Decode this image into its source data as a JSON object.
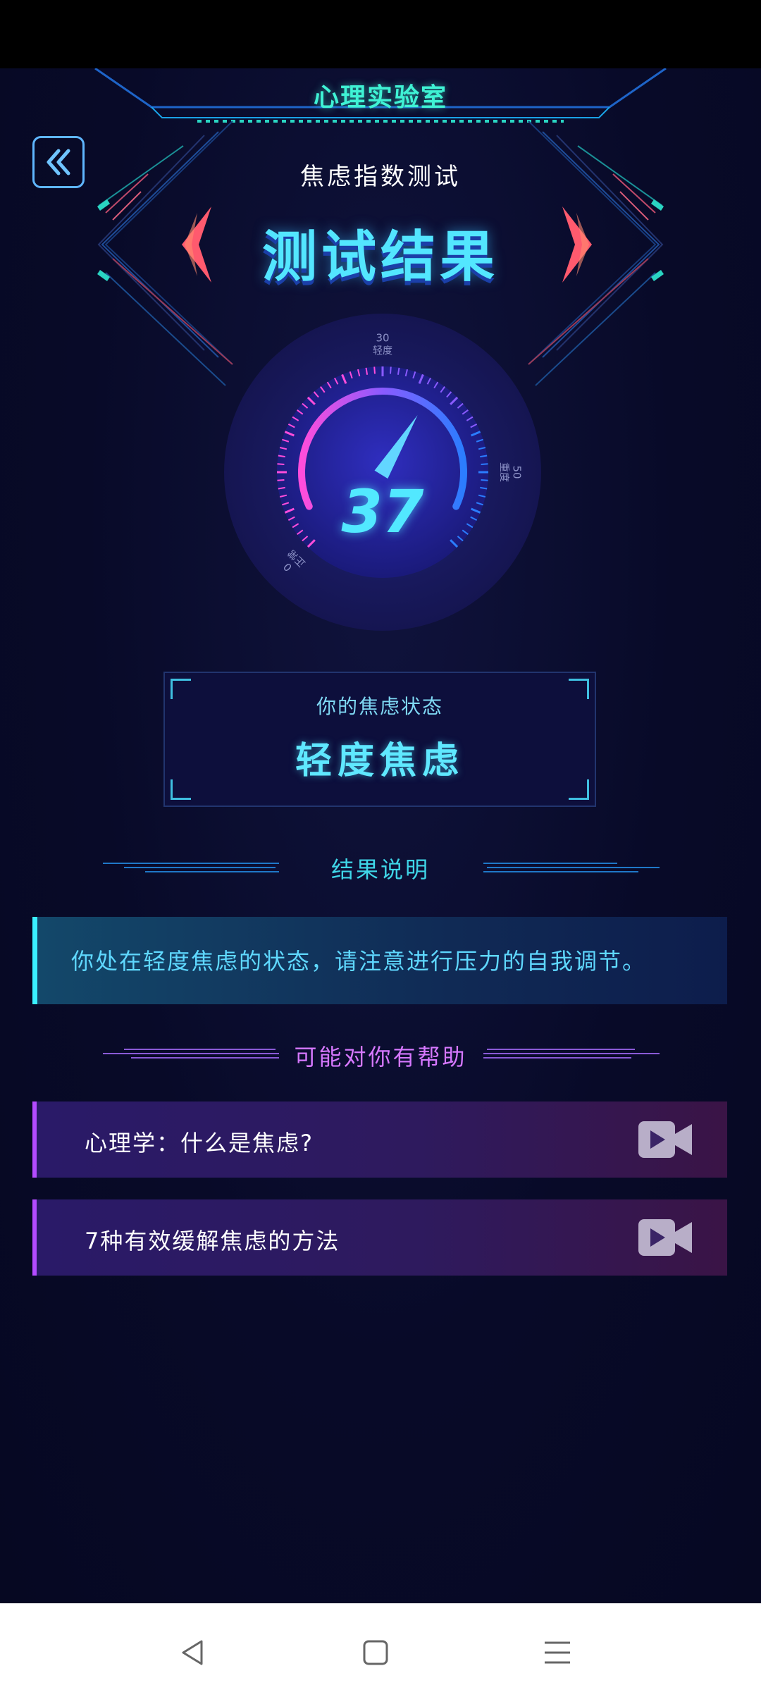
{
  "app": {
    "lab_title": "心理实验室",
    "subtitle": "焦虑指数测试",
    "result_title": "测试结果"
  },
  "gauge": {
    "score": "37",
    "max": 60,
    "level_value": 37,
    "ticks": [
      {
        "value": "0",
        "label": "正常"
      },
      {
        "value": "30",
        "label": "轻度"
      },
      {
        "value": "50",
        "label": "重度"
      }
    ],
    "colors": {
      "start": "#ff4ddb",
      "mid": "#8a5bff",
      "end": "#2b7dff",
      "number": "#52e8ff"
    }
  },
  "state": {
    "label": "你的焦虑状态",
    "value": "轻度焦虑"
  },
  "explanation": {
    "heading": "结果说明",
    "text": "你处在轻度焦虑的状态，请注意进行压力的自我调节。"
  },
  "help": {
    "heading": "可能对你有帮助",
    "items": [
      {
        "label": "心理学：什么是焦虑?",
        "icon": "video-camera-icon"
      },
      {
        "label": "7种有效缓解焦虑的方法",
        "icon": "video-camera-icon"
      }
    ]
  },
  "nav": {
    "back_icon": "back-triangle-icon",
    "home_icon": "home-square-icon",
    "menu_icon": "menu-lines-icon"
  }
}
